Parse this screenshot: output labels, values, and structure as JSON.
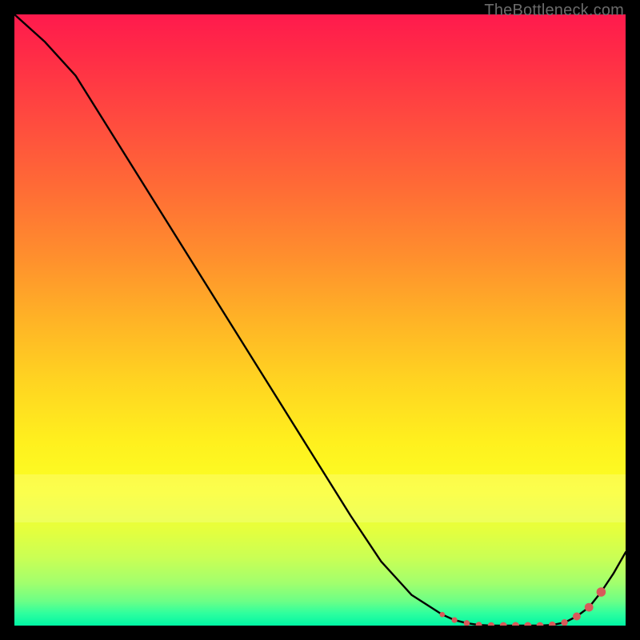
{
  "watermark": "TheBottleneck.com",
  "chart_data": {
    "type": "line",
    "x": [
      0,
      5,
      10,
      15,
      20,
      25,
      30,
      35,
      40,
      45,
      50,
      55,
      60,
      65,
      70,
      72,
      74,
      76,
      78,
      80,
      82,
      84,
      86,
      88,
      90,
      92,
      94,
      96,
      98,
      100
    ],
    "values": [
      100.0,
      95.5,
      90.0,
      82.0,
      74.0,
      66.0,
      58.0,
      50.0,
      42.0,
      34.0,
      26.0,
      18.0,
      10.5,
      5.0,
      1.8,
      0.9,
      0.4,
      0.1,
      0.0,
      0.0,
      0.0,
      0.0,
      0.0,
      0.1,
      0.5,
      1.5,
      3.0,
      5.5,
      8.5,
      12.0
    ],
    "xlabel": "",
    "ylabel": "",
    "xlim": [
      0,
      100
    ],
    "ylim": [
      0,
      100
    ],
    "title": "",
    "colors": {
      "gradient_top": "#ff1a4d",
      "gradient_bottom": "#00f6a4",
      "line": "#000000",
      "marker": "#d85a5a"
    }
  },
  "markers": {
    "x": [
      70,
      72,
      74,
      76,
      78,
      80,
      82,
      84,
      86,
      88,
      90,
      92,
      94,
      96
    ],
    "y": [
      1.8,
      0.9,
      0.4,
      0.1,
      0.0,
      0.0,
      0.0,
      0.0,
      0.0,
      0.1,
      0.5,
      1.5,
      3.0,
      5.5
    ],
    "radii": [
      3.3,
      3.6,
      3.8,
      4.0,
      4.2,
      4.4,
      4.5,
      4.5,
      4.4,
      4.3,
      4.2,
      5.0,
      5.4,
      5.8
    ]
  }
}
